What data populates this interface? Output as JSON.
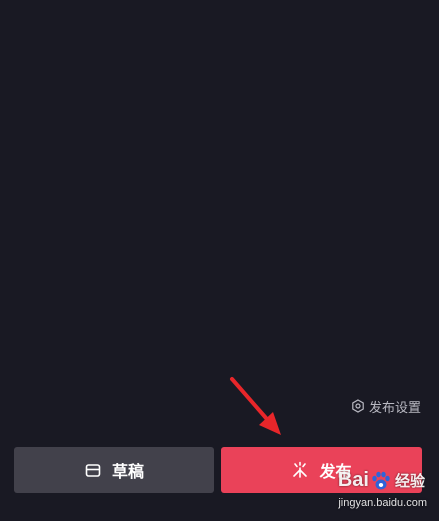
{
  "settings": {
    "label": "发布设置",
    "icon": "gear-outline-icon"
  },
  "footer": {
    "draft": {
      "label": "草稿",
      "icon": "draft-box-icon",
      "color": "#42414b"
    },
    "publish": {
      "label": "发布",
      "icon": "sparkle-icon",
      "color": "#ea4259"
    }
  },
  "colors": {
    "background": "#191923",
    "annotation_arrow": "#e8262a"
  },
  "watermark": {
    "brand_left": "Bai",
    "brand_right": "经验",
    "url": "jingyan.baidu.com"
  }
}
